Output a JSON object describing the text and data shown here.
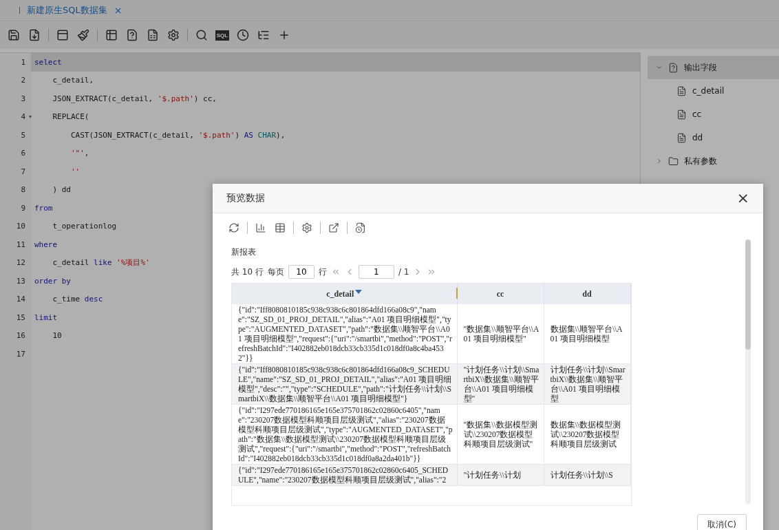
{
  "tabs": [
    {
      "label": "新建原生SQL数据集",
      "selected": true,
      "close": "×"
    }
  ],
  "toolbar": {
    "sql_badge": "SQL"
  },
  "editor": {
    "lines": [
      {
        "number": "1",
        "selected": true,
        "tokens": [
          {
            "kind": "keyword",
            "text": "select"
          }
        ]
      },
      {
        "number": "2",
        "selected": false,
        "tokens": [
          {
            "kind": "plain",
            "text": "    c_detail,"
          }
        ]
      },
      {
        "number": "3",
        "selected": false,
        "tokens": [
          {
            "kind": "plain",
            "text": "    JSON_EXTRACT(c_detail, "
          },
          {
            "kind": "string",
            "text": "'$.path'"
          },
          {
            "kind": "plain",
            "text": ") cc,"
          }
        ]
      },
      {
        "number": "4",
        "selected": false,
        "fold": "▾",
        "tokens": [
          {
            "kind": "plain",
            "text": "    REPLACE("
          }
        ]
      },
      {
        "number": "5",
        "selected": false,
        "tokens": [
          {
            "kind": "plain",
            "text": "        CAST(JSON_EXTRACT(c_detail, "
          },
          {
            "kind": "string",
            "text": "'$.path'"
          },
          {
            "kind": "plain",
            "text": ") "
          },
          {
            "kind": "keyword",
            "text": "AS"
          },
          {
            "kind": "type",
            "text": " CHAR"
          },
          {
            "kind": "plain",
            "text": "),"
          }
        ]
      },
      {
        "number": "6",
        "selected": false,
        "tokens": [
          {
            "kind": "string",
            "text": "        '\"'"
          },
          {
            "kind": "plain",
            "text": ","
          }
        ]
      },
      {
        "number": "7",
        "selected": false,
        "tokens": [
          {
            "kind": "string",
            "text": "        ''"
          }
        ]
      },
      {
        "number": "8",
        "selected": false,
        "tokens": [
          {
            "kind": "plain",
            "text": "    ) dd"
          }
        ]
      },
      {
        "number": "9",
        "selected": false,
        "tokens": [
          {
            "kind": "keyword",
            "text": "from"
          }
        ]
      },
      {
        "number": "10",
        "selected": false,
        "tokens": [
          {
            "kind": "plain",
            "text": "    t_operationlog"
          }
        ]
      },
      {
        "number": "11",
        "selected": false,
        "tokens": [
          {
            "kind": "keyword",
            "text": "where"
          }
        ]
      },
      {
        "number": "12",
        "selected": false,
        "tokens": [
          {
            "kind": "plain",
            "text": "    c_detail "
          },
          {
            "kind": "keyword",
            "text": "like"
          },
          {
            "kind": "string",
            "text": " '%项目%'"
          }
        ]
      },
      {
        "number": "13",
        "selected": false,
        "tokens": [
          {
            "kind": "keyword",
            "text": "order by"
          }
        ]
      },
      {
        "number": "14",
        "selected": false,
        "tokens": [
          {
            "kind": "plain",
            "text": "    c_time "
          },
          {
            "kind": "keyword",
            "text": "desc"
          }
        ]
      },
      {
        "number": "15",
        "selected": false,
        "tokens": [
          {
            "kind": "keyword",
            "text": "limit"
          }
        ]
      },
      {
        "number": "16",
        "selected": false,
        "tokens": [
          {
            "kind": "plain",
            "text": "    10"
          }
        ]
      },
      {
        "number": "17",
        "selected": false
      }
    ]
  },
  "field_tree": [
    {
      "label": "输出字段",
      "kind": "group",
      "expanded": true,
      "selected": true,
      "children": [
        {
          "label": "c_detail",
          "kind": "field",
          "selected": false
        },
        {
          "label": "cc",
          "kind": "field",
          "selected": false
        },
        {
          "label": "dd",
          "kind": "field",
          "selected": false
        }
      ]
    },
    {
      "label": "私有参数",
      "kind": "folder",
      "expanded": false,
      "selected": false
    }
  ],
  "dialog": {
    "title": "预览数据",
    "close": "×",
    "report_title": "新报表",
    "pagination": {
      "total": "共 10 行",
      "per_page_label": "每页",
      "per_page": "10",
      "rows_unit": "行",
      "page": "1",
      "page_count": "/ 1"
    },
    "table": {
      "columns": [
        {
          "label": "c_detail",
          "sorted": true
        },
        {
          "label": "cc",
          "sorted": false
        },
        {
          "label": "dd",
          "sorted": false
        }
      ],
      "rows": [
        [
          "{\"id\":\"Iff8080810185c938c938c6c801864dfd166a08c9\",\"name\":\"SZ_SD_01_PROJ_DETAIL\",\"alias\":\"A01 项目明细模型\",\"type\":\"AUGMENTED_DATASET\",\"path\":\"数据集\\\\顺智平台\\\\A01 项目明细模型\",\"request\":{\"uri\":\"/smartbi\",\"method\":\"POST\",\"refreshBatchId\":\"I402882eb018dcb33cb335d1c018df0a8c4ba4532\"}}",
          "\"数据集\\\\顺智平台\\\\A01 项目明细模型\"",
          "数据集\\\\顺智平台\\\\A01 项目明细模型"
        ],
        [
          "{\"id\":\"Iff8080810185c938c938c6c801864dfd166a08c9_SCHEDULE\",\"name\":\"SZ_SD_01_PROJ_DETAIL\",\"alias\":\"A01 项目明细模型\",\"desc\":\"\",\"type\":\"SCHEDULE\",\"path\":\"计划任务\\\\计划\\\\SmartbiX\\\\数据集\\\\顺智平台\\\\A01 项目明细模型\"}",
          "\"计划任务\\\\计划\\\\SmartbiX\\\\数据集\\\\顺智平台\\\\A01 项目明细模型\"",
          "计划任务\\\\计划\\\\SmartbiX\\\\数据集\\\\顺智平台\\\\A01 项目明细模型"
        ],
        [
          "{\"id\":\"I297ede770186165e165e375701862c02860c6405\",\"name\":\"230207数据模型科顺项目层级测试\",\"alias\":\"230207数据模型科顺项目层级测试\",\"type\":\"AUGMENTED_DATASET\",\"path\":\"数据集\\\\数据模型测试\\\\230207数据模型科顺项目层级测试\",\"request\":{\"uri\":\"/smartbi\",\"method\":\"POST\",\"refreshBatchId\":\"I402882eb018dcb33cb335d1c018df0a8a2da401b\"}}",
          "\"数据集\\\\数据模型测试\\\\230207数据模型科顺项目层级测试\"",
          "数据集\\\\数据模型测试\\\\230207数据模型科顺项目层级测试"
        ],
        [
          "{\"id\":\"I297ede770186165e165e375701862c02860c6405_SCHEDULE\",\"name\":\"230207数据模型科顺项目层级测试\",\"alias\":\"2",
          "\"计划任务\\\\计划",
          "计划任务\\\\计划\\\\S"
        ]
      ]
    },
    "buttons": [
      "取消(C)"
    ]
  }
}
